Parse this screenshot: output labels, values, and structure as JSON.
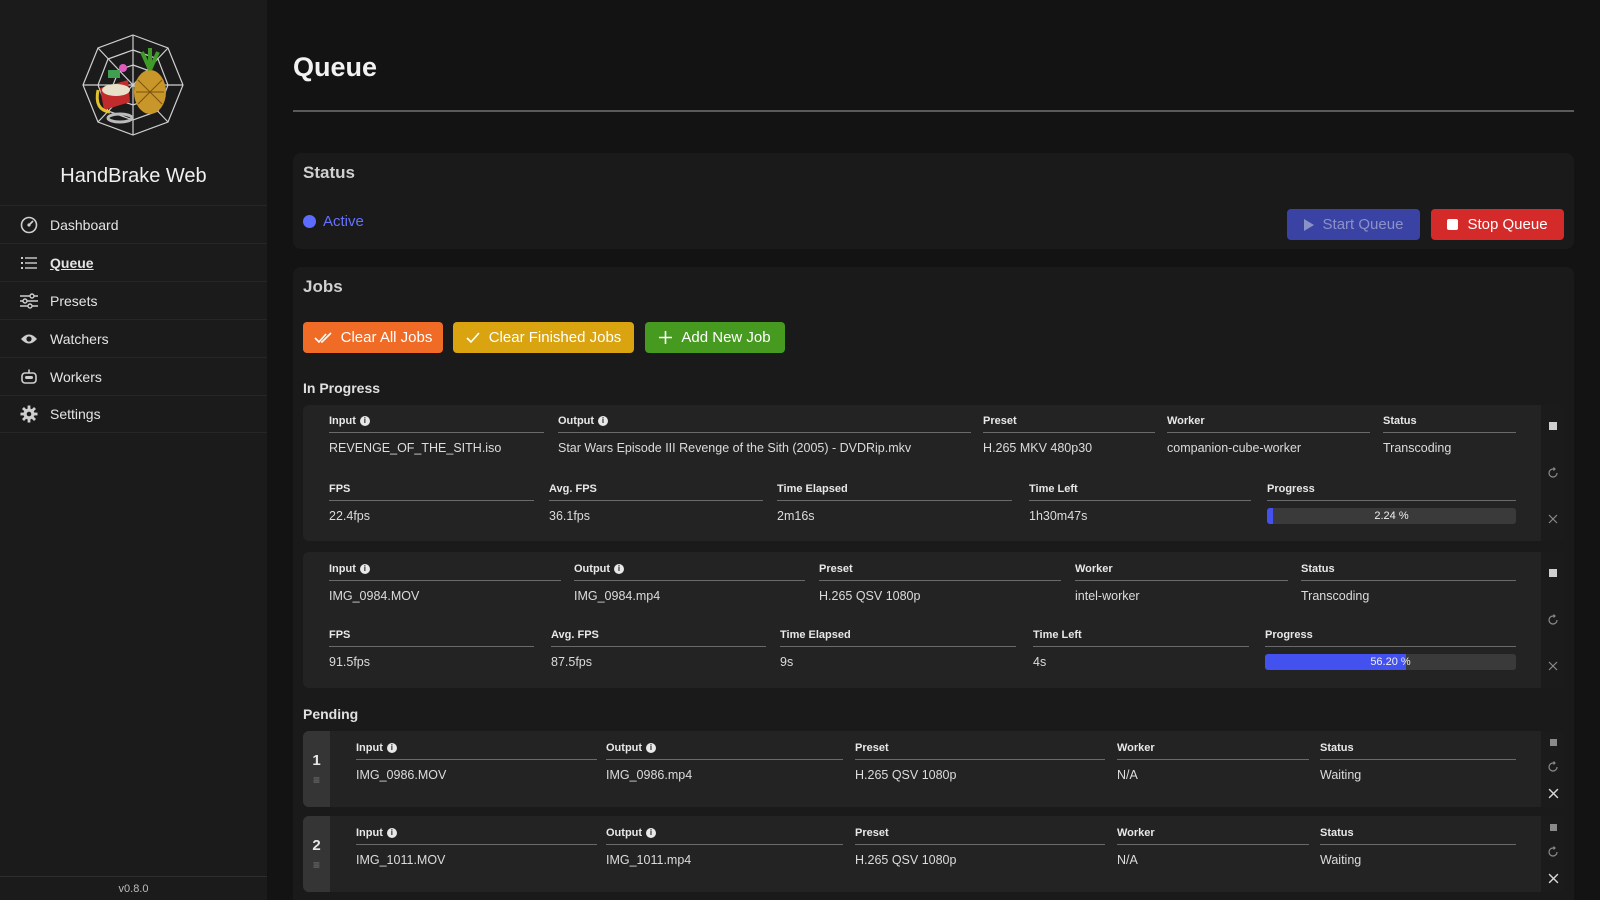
{
  "app": {
    "name": "HandBrake Web",
    "version": "v0.8.0"
  },
  "nav": {
    "items": [
      {
        "label": "Dashboard",
        "icon": "dashboard-icon"
      },
      {
        "label": "Queue",
        "icon": "list-icon",
        "active": true
      },
      {
        "label": "Presets",
        "icon": "sliders-icon"
      },
      {
        "label": "Watchers",
        "icon": "eye-icon"
      },
      {
        "label": "Workers",
        "icon": "robot-icon"
      },
      {
        "label": "Settings",
        "icon": "gear-icon"
      }
    ]
  },
  "page": {
    "title": "Queue"
  },
  "status": {
    "title": "Status",
    "state": "Active",
    "start_label": "Start Queue",
    "stop_label": "Stop Queue"
  },
  "jobs": {
    "title": "Jobs",
    "clear_all_label": "Clear All Jobs",
    "clear_finished_label": "Clear Finished Jobs",
    "add_label": "Add New Job",
    "in_progress_label": "In Progress",
    "pending_label": "Pending",
    "headers": {
      "input": "Input",
      "output": "Output",
      "preset": "Preset",
      "worker": "Worker",
      "status": "Status",
      "fps": "FPS",
      "avg_fps": "Avg. FPS",
      "time_elapsed": "Time Elapsed",
      "time_left": "Time Left",
      "progress": "Progress"
    },
    "in_progress": [
      {
        "input": "REVENGE_OF_THE_SITH.iso",
        "output": "Star Wars Episode III Revenge of the Sith (2005) - DVDRip.mkv",
        "preset": "H.265 MKV 480p30",
        "worker": "companion-cube-worker",
        "status": "Transcoding",
        "fps": "22.4fps",
        "avg_fps": "36.1fps",
        "time_elapsed": "2m16s",
        "time_left": "1h30m47s",
        "progress_text": "2.24 %",
        "progress": 2.24
      },
      {
        "input": "IMG_0984.MOV",
        "output": "IMG_0984.mp4",
        "preset": "H.265 QSV 1080p",
        "worker": "intel-worker",
        "status": "Transcoding",
        "fps": "91.5fps",
        "avg_fps": "87.5fps",
        "time_elapsed": "9s",
        "time_left": "4s",
        "progress_text": "56.20 %",
        "progress": 56.2
      }
    ],
    "pending": [
      {
        "num": "1",
        "input": "IMG_0986.MOV",
        "output": "IMG_0986.mp4",
        "preset": "H.265 QSV 1080p",
        "worker": "N/A",
        "status": "Waiting"
      },
      {
        "num": "2",
        "input": "IMG_1011.MOV",
        "output": "IMG_1011.mp4",
        "preset": "H.265 QSV 1080p",
        "worker": "N/A",
        "status": "Waiting"
      }
    ]
  },
  "colors": {
    "accent": "#5c6cff",
    "stop": "#d52a2a",
    "clear_all": "#ef6b26",
    "clear_finished": "#d9a40f",
    "add": "#479a20",
    "progress": "#4352ee"
  }
}
